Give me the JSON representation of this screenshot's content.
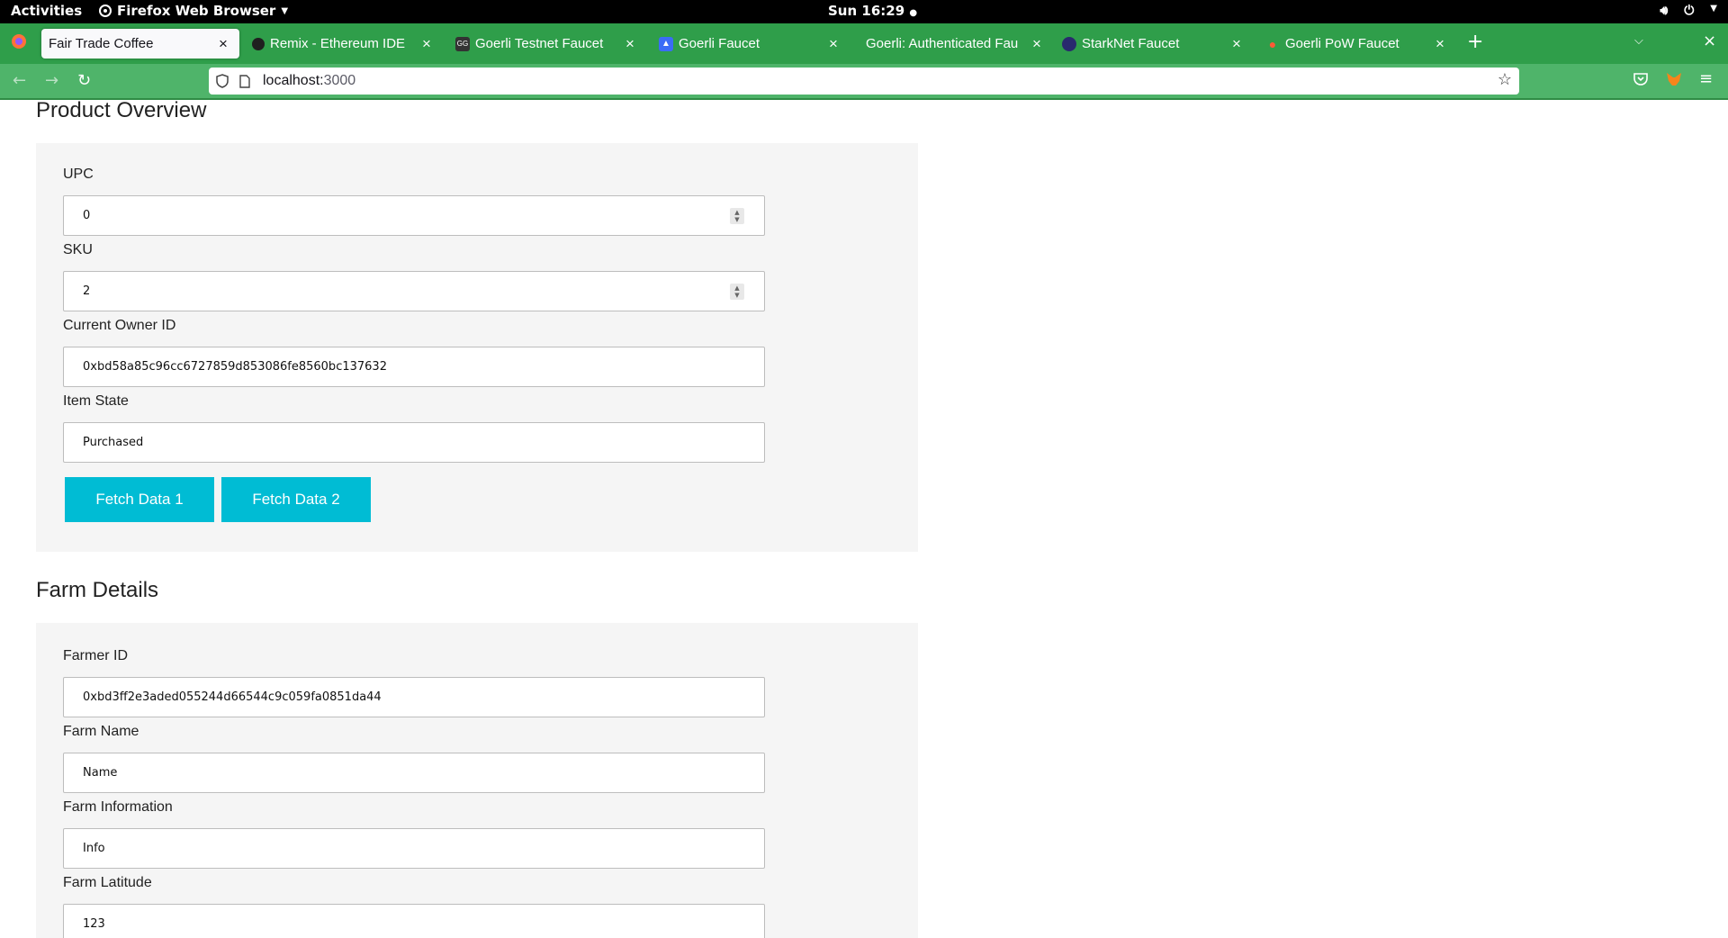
{
  "topbar": {
    "activities": "Activities",
    "app_name": "Firefox Web Browser",
    "clock": "Sun 16:29"
  },
  "tabs": [
    {
      "title": "Fair Trade Coffee",
      "favicon": "firefox-icon",
      "active": true
    },
    {
      "title": "Remix - Ethereum IDE",
      "favicon": "remix-icon"
    },
    {
      "title": "Goerli Testnet Faucet",
      "favicon": "faucet-icon"
    },
    {
      "title": "Goerli Faucet",
      "favicon": "alchemy-icon"
    },
    {
      "title": "Goerli: Authenticated Fau",
      "favicon": "none"
    },
    {
      "title": "StarkNet Faucet",
      "favicon": "starknet-icon"
    },
    {
      "title": "Goerli PoW Faucet",
      "favicon": "flame-icon"
    }
  ],
  "url": {
    "host": "localhost:",
    "port": "3000"
  },
  "product_overview": {
    "title": "Product Overview",
    "upc_label": "UPC",
    "upc_value": "0",
    "sku_label": "SKU",
    "sku_value": "2",
    "owner_label": "Current Owner ID",
    "owner_value": "0xbd58a85c96cc6727859d853086fe8560bc137632",
    "state_label": "Item State",
    "state_value": "Purchased",
    "fetch1": "Fetch Data 1",
    "fetch2": "Fetch Data 2"
  },
  "farm_details": {
    "title": "Farm Details",
    "farmer_id_label": "Farmer ID",
    "farmer_id_value": "0xbd3ff2e3aded055244d66544c9c059fa0851da44",
    "farm_name_label": "Farm Name",
    "farm_name_value": "Name",
    "farm_info_label": "Farm Information",
    "farm_info_value": "Info",
    "farm_lat_label": "Farm Latitude",
    "farm_lat_value": "123"
  },
  "colors": {
    "tabbar": "#2f9e4a",
    "navbar": "#4fb46a",
    "button": "#00bcd4",
    "card": "#f5f5f5"
  }
}
